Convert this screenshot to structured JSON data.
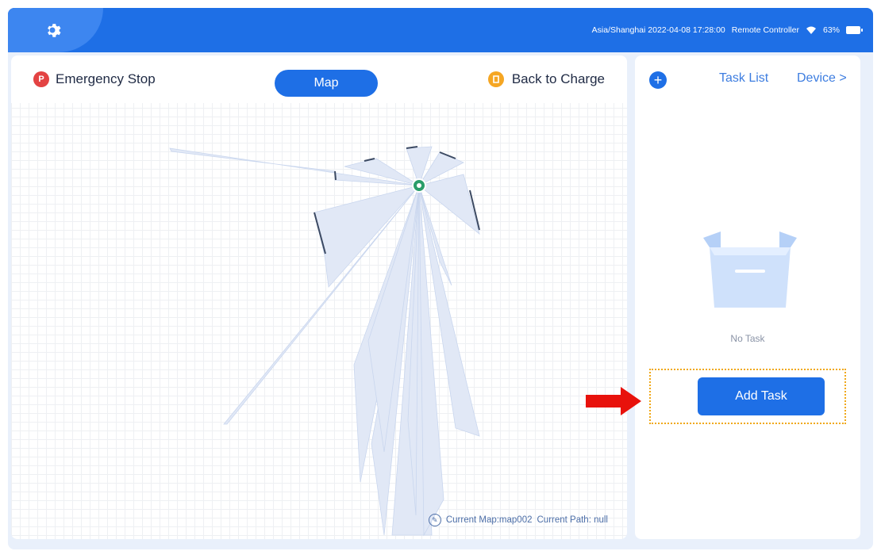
{
  "topbar": {
    "status_text": "Asia/Shanghai 2022-04-08 17:28:00",
    "mode": "Remote Controller",
    "battery": "63%",
    "colors": {
      "bar": "#1e6fe6",
      "tab": "#3d86f0"
    }
  },
  "map_panel": {
    "emergency_stop": "Emergency Stop",
    "emergency_icon": "P",
    "map_tab": "Map",
    "back_to_charge": "Back to Charge",
    "current_map": "Current Map:map002",
    "current_path": "Current Path: null"
  },
  "task_panel": {
    "add_icon": "+",
    "task_list": "Task List",
    "device": "Device >",
    "empty_text": "No Task",
    "add_task": "Add Task"
  },
  "colors": {
    "accent": "#1e6fe6",
    "danger": "#e34343",
    "warning": "#f5a623",
    "annotation": "#f0a818",
    "arrow": "#e8120c"
  }
}
